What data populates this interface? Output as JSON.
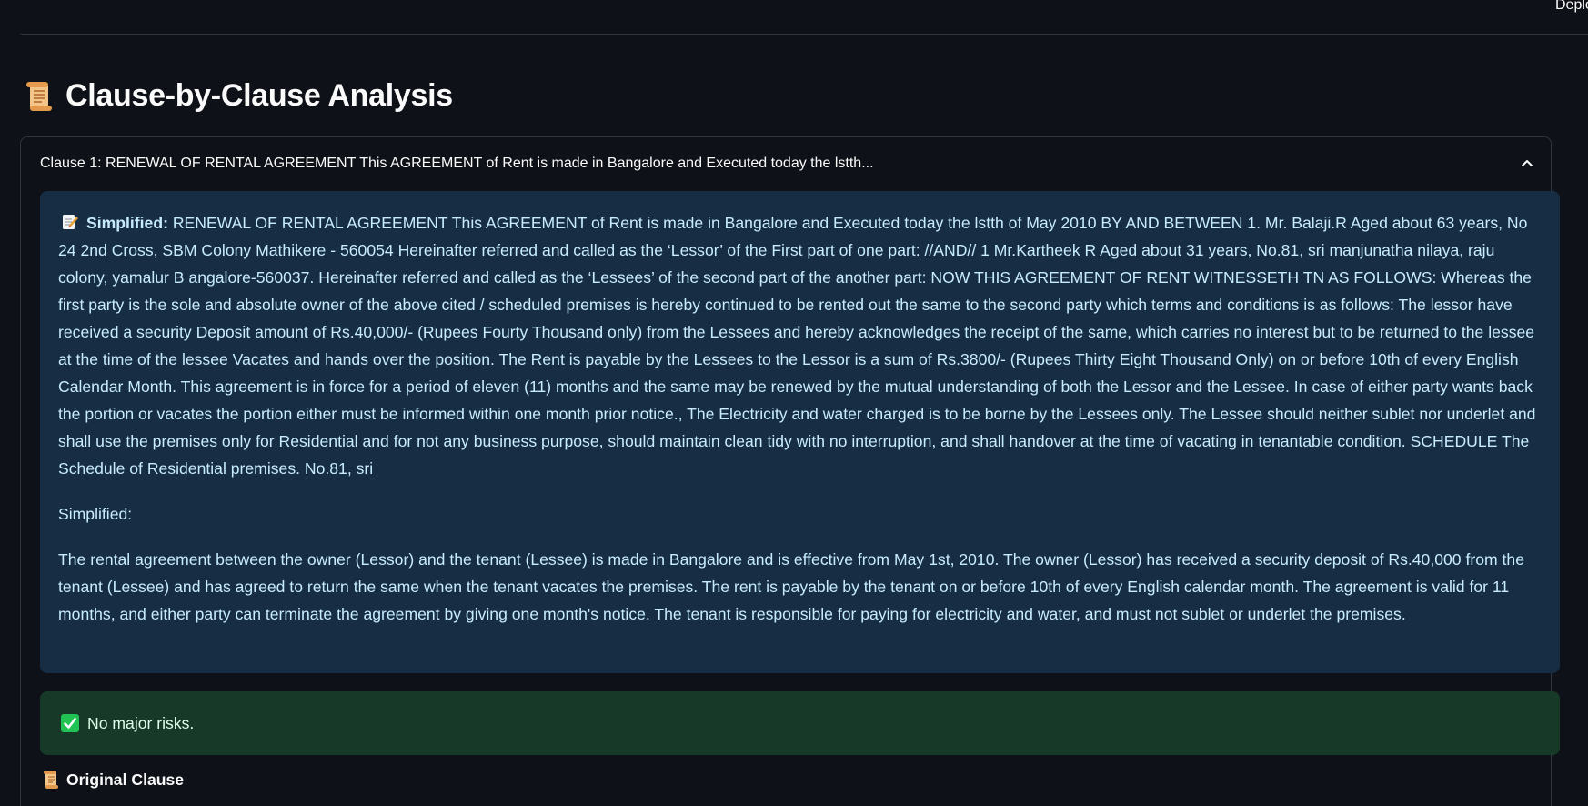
{
  "header": {
    "deploy_label": "Deploy"
  },
  "section": {
    "title": "Clause-by-Clause Analysis",
    "icon": "scroll-icon"
  },
  "clause": {
    "expander_title": "Clause 1: RENEWAL OF RENTAL AGREEMENT This AGREEMENT of Rent is made in Bangalore and Executed today the lstth...",
    "simplified_label": "Simplified:",
    "original_text": "RENEWAL OF RENTAL AGREEMENT This AGREEMENT of Rent is made in Bangalore and Executed today the lstth of May 2010 BY AND BETWEEN 1. Mr. Balaji.R Aged about 63 years, No 24 2nd Cross, SBM Colony Mathikere - 560054 Hereinafter referred and called as the ‘Lessor’ of the First part of one part: //AND// 1 Mr.Kartheek R Aged about 31 years, No.81, sri manjunatha nilaya, raju colony, yamalur B angalore-560037. Hereinafter referred and called as the ‘Lessees’ of the second part of the another part: NOW THIS AGREEMENT OF RENT WITNESSETH TN AS FOLLOWS: Whereas the first party is the sole and absolute owner of the above cited / scheduled premises is hereby continued to be rented out the same to the second party which terms and conditions is as follows: The lessor have received a security Deposit amount of Rs.40,000/- (Rupees Fourty Thousand only) from the Lessees and hereby acknowledges the receipt of the same, which carries no interest but to be returned to the lessee at the time of the lessee Vacates and hands over the position. The Rent is payable by the Lessees to the Lessor is a sum of Rs.3800/- (Rupees Thirty Eight Thousand Only) on or before 10th of every English Calendar Month. This agreement is in force for a period of eleven (11) months and the same may be renewed by the mutual understanding of both the Lessor and the Lessee. In case of either party wants back the portion or vacates the portion either must be informed within one month prior notice., The Electricity and water charged is to be borne by the Lessees only. The Lessee should neither sublet nor underlet and shall use the premises only for Residential and for not any business purpose, should maintain clean tidy with no interruption, and shall handover at the time of vacating in tenantable condition. SCHEDULE The Schedule of Residential premises. No.81, sri",
    "second_label": "Simplified:",
    "simplified_text": "The rental agreement between the owner (Lessor) and the tenant (Lessee) is made in Bangalore and is effective from May 1st, 2010. The owner (Lessor) has received a security deposit of Rs.40,000 from the tenant (Lessee) and has agreed to return the same when the tenant vacates the premises. The rent is payable by the tenant on or before 10th of every English calendar month. The agreement is valid for 11 months, and either party can terminate the agreement by giving one month's notice. The tenant is responsible for paying for electricity and water, and must not sublet or underlet the premises.",
    "risk_text": "No major risks.",
    "original_heading": "Original Clause"
  },
  "colors": {
    "background": "#0e1117",
    "info_bg": "#172d43",
    "info_text": "#c7ebff",
    "success_bg": "#173928",
    "success_text": "#dffde9",
    "check": "#21c354"
  }
}
